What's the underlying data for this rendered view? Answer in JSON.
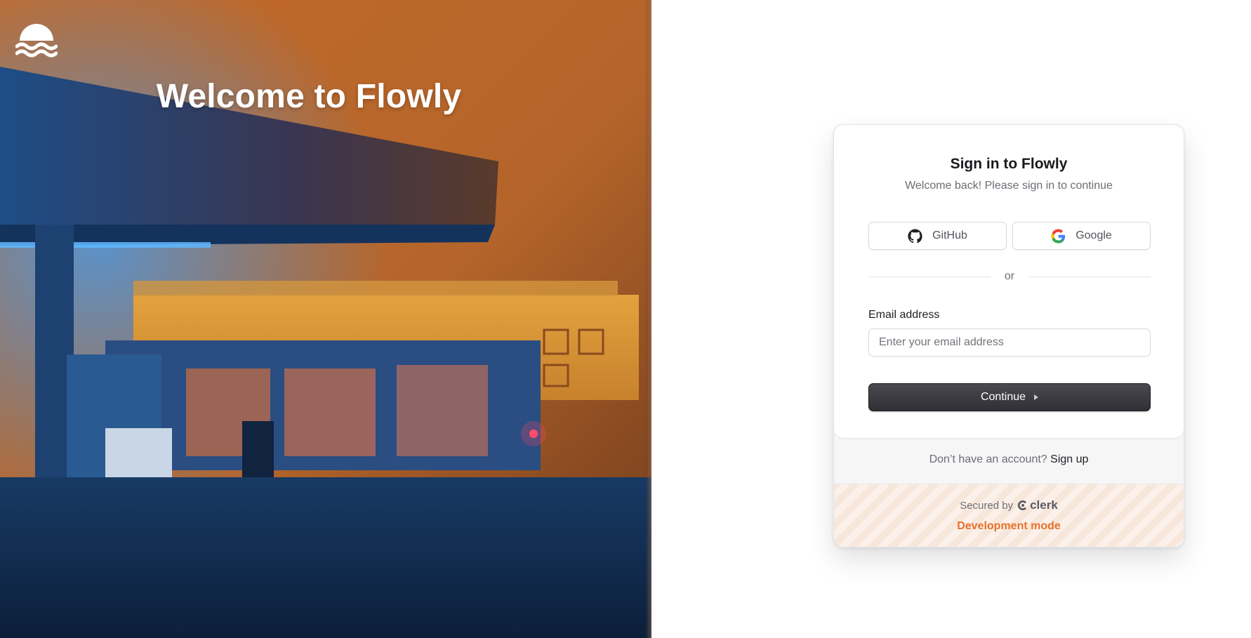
{
  "hero": {
    "title": "Welcome to Flowly",
    "logo_icon": "waves-logo-icon"
  },
  "card": {
    "title": "Sign in to Flowly",
    "subtitle": "Welcome back! Please sign in to continue",
    "oauth": {
      "github_label": "GitHub",
      "github_icon": "github-icon",
      "google_label": "Google",
      "google_icon": "google-icon"
    },
    "divider_text": "or",
    "email": {
      "label": "Email address",
      "placeholder": "Enter your email address",
      "value": ""
    },
    "continue_label": "Continue",
    "signup": {
      "prompt": "Don’t have an account?",
      "link_label": "Sign up"
    },
    "footer": {
      "secured_by": "Secured by",
      "brand": "clerk",
      "dev_mode": "Development mode"
    }
  },
  "colors": {
    "primary_button": "#2f2f35",
    "dev_mode": "#e8712a",
    "text_muted": "#6d6d75"
  }
}
